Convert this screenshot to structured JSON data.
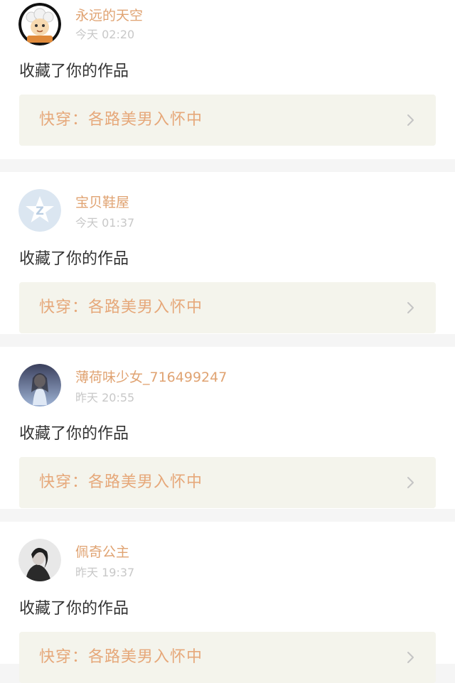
{
  "notifications": [
    {
      "username": "永远的天空",
      "time": "今天 02:20",
      "action": "收藏了你的作品",
      "work_title": "快穿：各路美男入怀中",
      "avatar_icon": "cartoon-sheep-avatar-icon"
    },
    {
      "username": "宝贝鞋屋",
      "time": "今天 01:37",
      "action": "收藏了你的作品",
      "work_title": "快穿：各路美男入怀中",
      "avatar_icon": "default-star-avatar-icon"
    },
    {
      "username": "薄荷味少女_716499247",
      "time": "昨天 20:55",
      "action": "收藏了你的作品",
      "work_title": "快穿：各路美男入怀中",
      "avatar_icon": "photo-avatar-icon"
    },
    {
      "username": "佩奇公主",
      "time": "昨天 19:37",
      "action": "收藏了你的作品",
      "work_title": "快穿：各路美男入怀中",
      "avatar_icon": "photo-avatar-icon"
    }
  ],
  "colors": {
    "username": "#e0a372",
    "work_title": "#e6a87a",
    "time": "#c8c8c8",
    "work_bg": "#f4f4ec"
  }
}
